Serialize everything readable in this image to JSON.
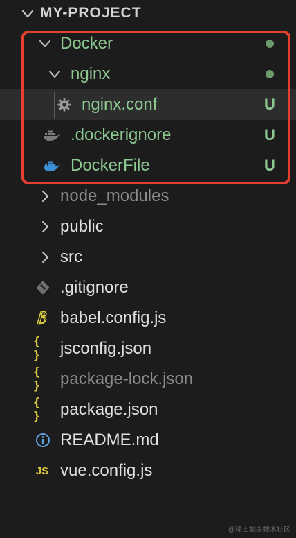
{
  "explorer": {
    "project_title": "MY-PROJECT"
  },
  "tree": {
    "docker": {
      "label": "Docker"
    },
    "nginx": {
      "label": "nginx"
    },
    "nginx_conf": {
      "label": "nginx.conf",
      "status": "U"
    },
    "dockerignore": {
      "label": ".dockerignore",
      "status": "U"
    },
    "dockerfile": {
      "label": "DockerFile",
      "status": "U"
    },
    "node_modules": {
      "label": "node_modules"
    },
    "public": {
      "label": "public"
    },
    "src": {
      "label": "src"
    },
    "gitignore": {
      "label": ".gitignore"
    },
    "babel_config": {
      "label": "babel.config.js"
    },
    "jsconfig": {
      "label": "jsconfig.json",
      "icon_text": "{ }"
    },
    "package_lock": {
      "label": "package-lock.json",
      "icon_text": "{ }"
    },
    "package_json": {
      "label": "package.json",
      "icon_text": "{ }"
    },
    "readme": {
      "label": "README.md"
    },
    "vue_config": {
      "label": "vue.config.js",
      "icon_text": "JS"
    }
  },
  "colors": {
    "background": "#1c1c1c",
    "untracked_green": "#8dc891",
    "ignored_gray": "#8a8a8a",
    "highlight_red": "#e5402f",
    "json_yellow": "#d7c53c",
    "docker_blue": "#3b8fd6"
  },
  "watermark": "@稀土掘金技术社区"
}
